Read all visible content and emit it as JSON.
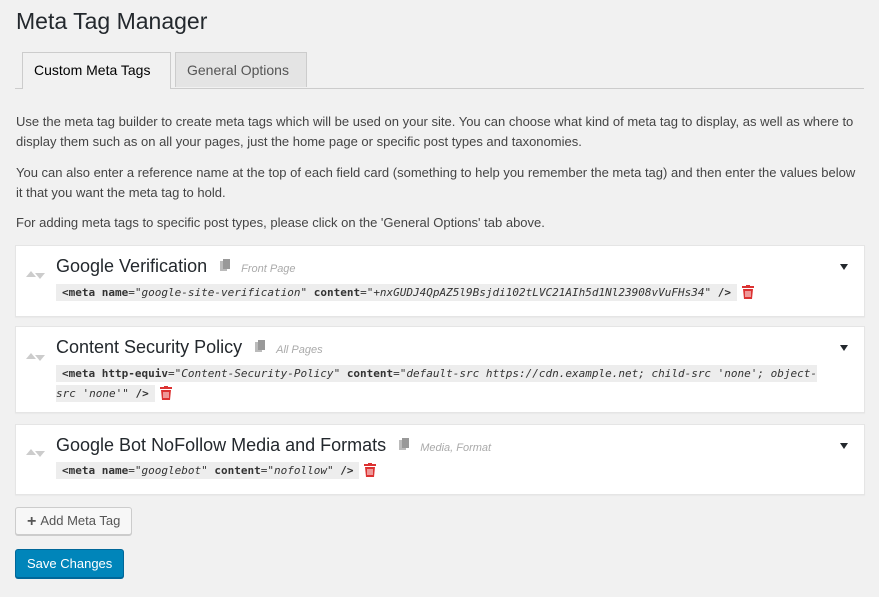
{
  "page": {
    "title": "Meta Tag Manager"
  },
  "tabs": [
    {
      "label": "Custom Meta Tags",
      "active": true
    },
    {
      "label": "General Options",
      "active": false
    }
  ],
  "intro": {
    "p1": "Use the meta tag builder to create meta tags which will be used on your site. You can choose what kind of meta tag to display, as well as where to display them such as on all your pages, just the home page or specific post types and taxonomies.",
    "p2": "You can also enter a reference name at the top of each field card (something to help you remember the meta tag) and then enter the values below it that you want the meta tag to hold.",
    "p3": "For adding meta tags to specific post types, please click on the 'General Options' tab above."
  },
  "cards": [
    {
      "title": "Google Verification",
      "scope": "Front Page",
      "attr1_name": "name",
      "attr1_value": "google-site-verification",
      "attr2_name": "content",
      "attr2_value": "+nxGUDJ4QpAZ5l9Bsjdi102tLVC21AIh5d1Nl23908vVuFHs34"
    },
    {
      "title": "Content Security Policy",
      "scope": "All Pages",
      "attr1_name": "http-equiv",
      "attr1_value": "Content-Security-Policy",
      "attr2_name": "content",
      "attr2_value": "default-src https://cdn.example.net; child-src 'none'; object-src 'none'"
    },
    {
      "title": "Google Bot NoFollow Media and Formats",
      "scope": "Media, Format",
      "attr1_name": "name",
      "attr1_value": "googlebot",
      "attr2_name": "content",
      "attr2_value": "nofollow"
    }
  ],
  "code": {
    "open": "<meta",
    "close": "/>",
    "eq": "=",
    "quote": "\""
  },
  "buttons": {
    "add_label": "Add Meta Tag",
    "save_label": "Save Changes"
  },
  "colors": {
    "accent": "#0085ba",
    "trash": "#dc3232"
  },
  "icons": {
    "copy": "copy-icon",
    "trash": "trash-icon",
    "drag": "drag-handle-icon",
    "toggle": "triangle-down-icon",
    "plus": "plus-icon"
  }
}
